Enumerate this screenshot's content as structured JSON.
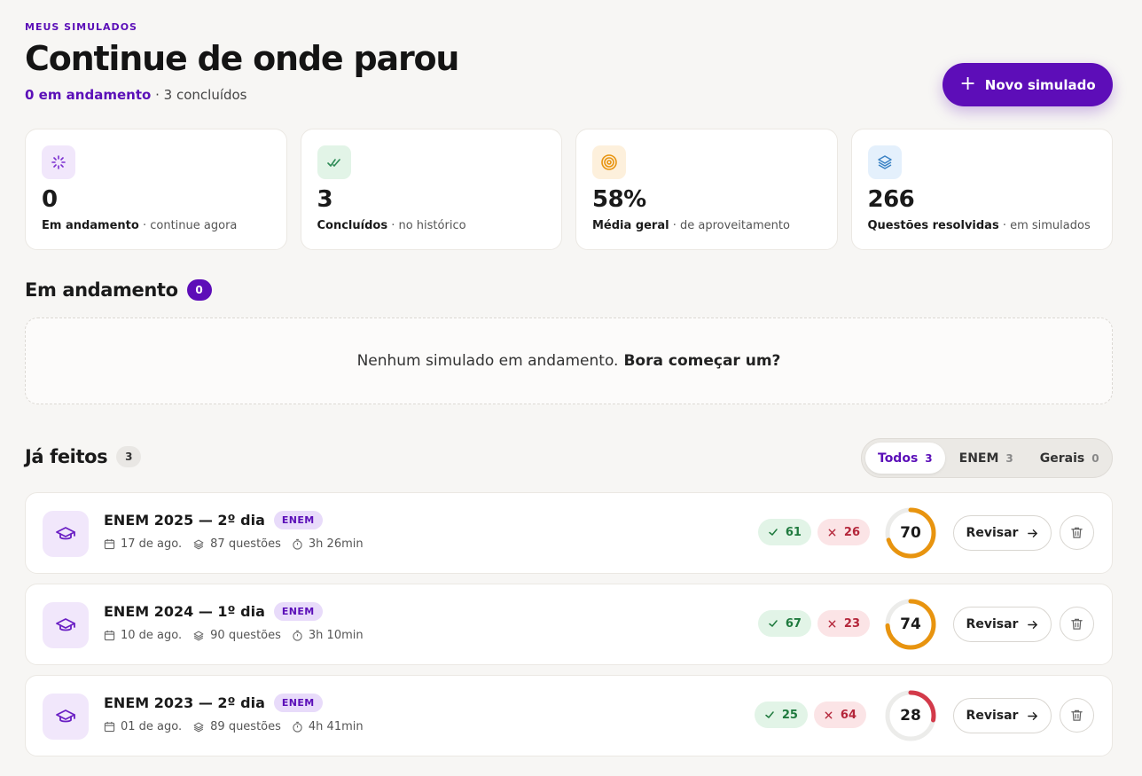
{
  "header": {
    "eyebrow": "MEUS SIMULADOS",
    "title": "Continue de onde parou",
    "in_progress_text": "0 em andamento",
    "separator": "·",
    "completed_text": "3 concluídos",
    "new_button_label": "Novo simulado",
    "new_button_icon": "plus-icon"
  },
  "stats": [
    {
      "value": "0",
      "label": "Em andamento",
      "detail": "· continue agora",
      "icon": "spinner-icon",
      "icon_bg": "#f1e7fb",
      "icon_color": "#7b2fd0"
    },
    {
      "value": "3",
      "label": "Concluídos",
      "detail": "· no histórico",
      "icon": "double-check-icon",
      "icon_bg": "#e2f4e7",
      "icon_color": "#2e8b57"
    },
    {
      "value": "58%",
      "label": "Média geral",
      "detail": "· de aproveitamento",
      "icon": "target-icon",
      "icon_bg": "#fdf0dc",
      "icon_color": "#e8940f"
    },
    {
      "value": "266",
      "label": "Questões resolvidas",
      "detail": "· em simulados",
      "icon": "layers-icon",
      "icon_bg": "#e4f0fc",
      "icon_color": "#3b82c4"
    }
  ],
  "in_progress": {
    "title": "Em andamento",
    "count": "0",
    "empty_text": "Nenhum simulado em andamento.",
    "empty_cta": "Bora começar um?"
  },
  "done": {
    "title": "Já feitos",
    "count": "3",
    "filters": [
      {
        "label": "Todos",
        "count": "3",
        "active": true
      },
      {
        "label": "ENEM",
        "count": "3",
        "active": false
      },
      {
        "label": "Gerais",
        "count": "0",
        "active": false
      }
    ],
    "review_label": "Revisar",
    "items": [
      {
        "name": "ENEM 2025 — 2º dia",
        "tag": "ENEM",
        "date": "17 de ago.",
        "questions": "87 questões",
        "duration": "3h 26min",
        "correct": "61",
        "wrong": "26",
        "score": 70,
        "ring_color": "#e8940f"
      },
      {
        "name": "ENEM 2024 — 1º dia",
        "tag": "ENEM",
        "date": "10 de ago.",
        "questions": "90 questões",
        "duration": "3h 10min",
        "correct": "67",
        "wrong": "23",
        "score": 74,
        "ring_color": "#e8940f"
      },
      {
        "name": "ENEM 2023 — 2º dia",
        "tag": "ENEM",
        "date": "01 de ago.",
        "questions": "89 questões",
        "duration": "4h 41min",
        "correct": "25",
        "wrong": "64",
        "score": 28,
        "ring_color": "#d33a4a"
      }
    ]
  }
}
